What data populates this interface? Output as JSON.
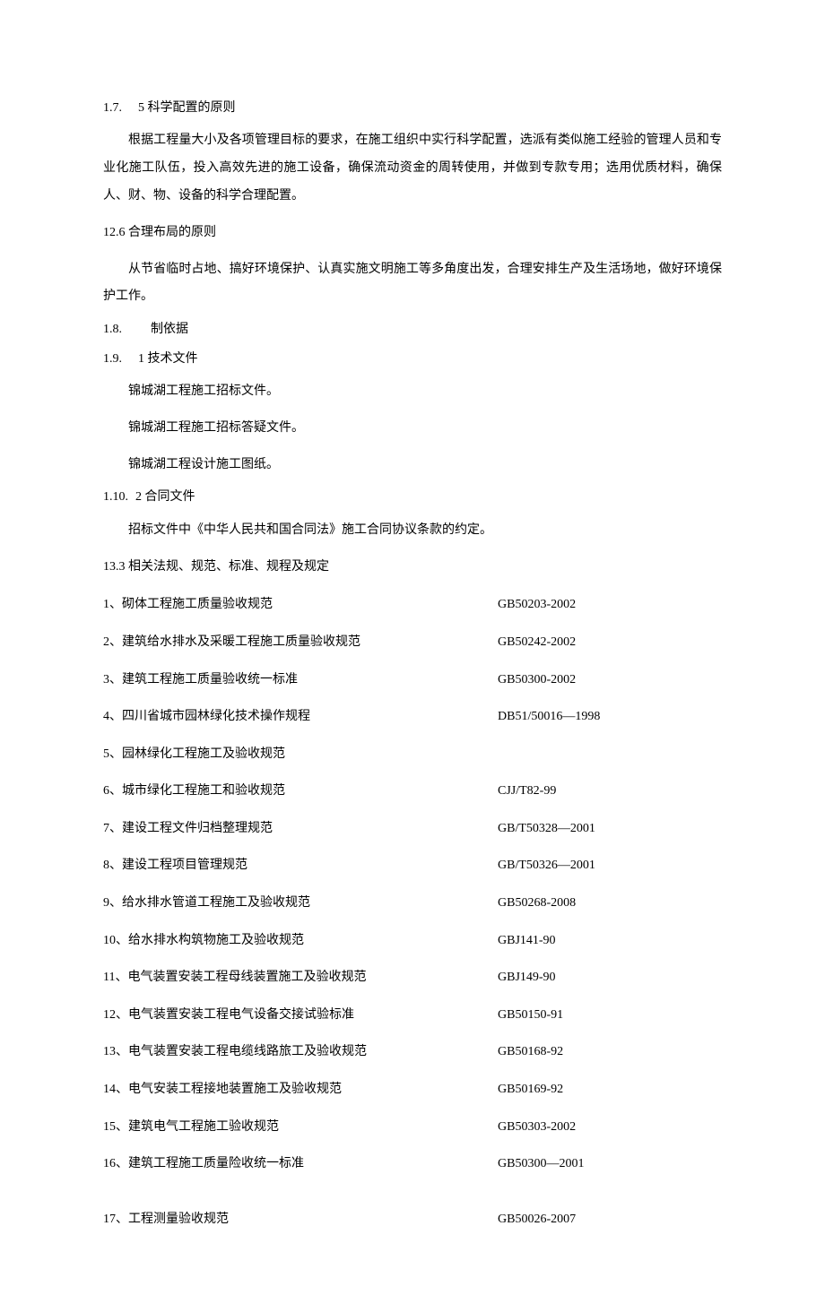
{
  "section_1_7": {
    "num": "1.7.",
    "title": "5 科学配置的原则",
    "para": "根据工程量大小及各项管理目标的要求，在施工组织中实行科学配置，选派有类似施工经验的管理人员和专业化施工队伍，投入高效先进的施工设备，确保流动资金的周转使用，并做到专款专用；选用优质材料，确保人、财、物、设备的科学合理配置。"
  },
  "section_12_6": {
    "title": "12.6 合理布局的原则",
    "para": "从节省临时占地、搞好环境保护、认真实施文明施工等多角度出发，合理安排生产及生活场地，做好环境保护工作。"
  },
  "section_1_8": {
    "num": "1.8.",
    "title": "制依据"
  },
  "section_1_9": {
    "num": "1.9.",
    "title": "1 技术文件",
    "items": [
      "锦城湖工程施工招标文件。",
      "锦城湖工程施工招标答疑文件。",
      "锦城湖工程设计施工图纸。"
    ]
  },
  "section_1_10": {
    "num": "1.10.",
    "title": "2 合同文件",
    "para": "招标文件中《中华人民共和国合同法》施工合同协议条款的约定。"
  },
  "section_13_3": {
    "title": "13.3 相关法规、规范、标准、规程及规定",
    "rows": [
      {
        "left": "1、砌体工程施工质量验收规范",
        "right": "GB50203-2002"
      },
      {
        "left": "2、建筑给水排水及采暖工程施工质量验收规范",
        "right": "GB50242-2002"
      },
      {
        "left": "3、建筑工程施工质量验收统一标准",
        "right": "GB50300-2002"
      },
      {
        "left": "4、四川省城市园林绿化技术操作规程",
        "right": "DB51/50016—1998"
      },
      {
        "left": "5、园林绿化工程施工及验收规范",
        "right": ""
      },
      {
        "left": "6、城市绿化工程施工和验收规范",
        "right": "CJJ/T82-99"
      },
      {
        "left": "7、建设工程文件归档整理规范",
        "right": "GB/T50328—2001"
      },
      {
        "left": "8、建设工程项目管理规范",
        "right": "GB/T50326—2001"
      },
      {
        "left": "9、给水排水管道工程施工及验收规范",
        "right": "GB50268-2008"
      },
      {
        "left": "10、给水排水构筑物施工及验收规范",
        "right": "GBJ141-90"
      },
      {
        "left": "11、电气装置安装工程母线装置施工及验收规范",
        "right": "GBJ149-90"
      },
      {
        "left": "12、电气装置安装工程电气设备交接试验标准",
        "right": "GB50150-91"
      },
      {
        "left": "13、电气装置安装工程电缆线路旅工及验收规范",
        "right": "GB50168-92"
      },
      {
        "left": "14、电气安装工程接地装置施工及验收规范",
        "right": "GB50169-92"
      },
      {
        "left": "15、建筑电气工程施工验收规范",
        "right": "GB50303-2002"
      },
      {
        "left": "16、建筑工程施工质量险收统一标准",
        "right": "GB50300—2001"
      }
    ],
    "last_row": {
      "left": "17、工程测量验收规范",
      "right": "GB50026-2007"
    }
  }
}
